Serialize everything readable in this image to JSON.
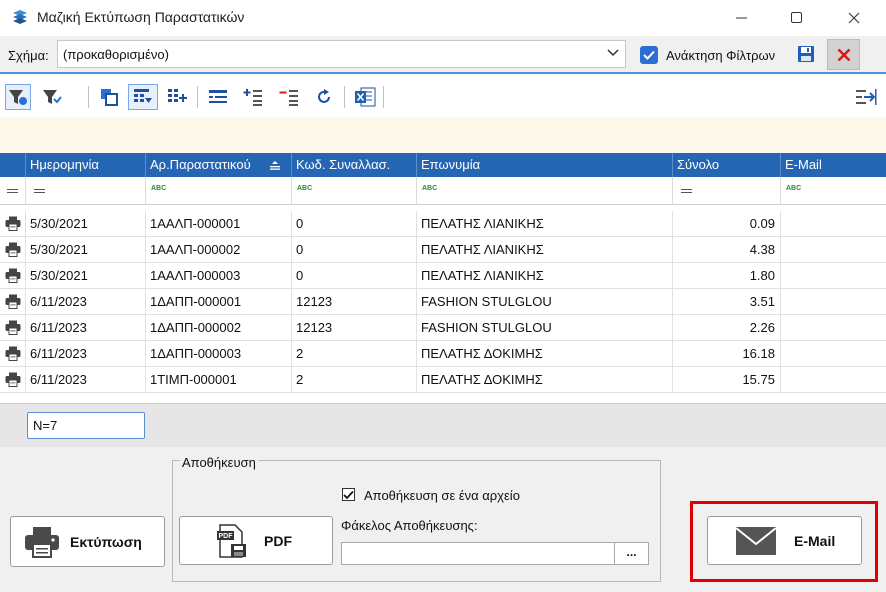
{
  "window": {
    "title": "Μαζική Εκτύπωση Παραστατικών",
    "minimize_glyph": "—",
    "maximize_glyph": "☐",
    "close_glyph": "✕"
  },
  "schema": {
    "label": "Σχήμα:",
    "value": "(προκαθορισμένο)",
    "filter_recall_label": "Ανάκτηση Φίλτρων",
    "filter_recall_checked": true
  },
  "toolbar": {
    "icons": [
      "filter-apply-icon",
      "filter-clear-icon",
      "copy-icon",
      "grid-options-icon",
      "add-columns-icon",
      "layout-icon",
      "expand-icon",
      "collapse-icon",
      "refresh-icon",
      "excel-export-icon",
      "pin-right-icon"
    ]
  },
  "grid": {
    "columns": [
      "Ημερομηνία",
      "Αρ.Παραστατικού",
      "Κωδ. Συναλλασ.",
      "Επωνυμία",
      "Σύνολο",
      "E-Mail"
    ],
    "sort_indicator": "≏",
    "filter_ops": [
      "=",
      "ABC",
      "ABC",
      "ABC",
      "=",
      "ABC"
    ],
    "rows": [
      {
        "date": "5/30/2021",
        "doc": "1ΑΑΛΠ-000001",
        "code": "0",
        "name": "ΠΕΛΑΤΗΣ ΛΙΑΝΙΚΗΣ",
        "total": "0.09",
        "email": ""
      },
      {
        "date": "5/30/2021",
        "doc": "1ΑΑΛΠ-000002",
        "code": "0",
        "name": "ΠΕΛΑΤΗΣ ΛΙΑΝΙΚΗΣ",
        "total": "4.38",
        "email": ""
      },
      {
        "date": "5/30/2021",
        "doc": "1ΑΑΛΠ-000003",
        "code": "0",
        "name": "ΠΕΛΑΤΗΣ ΛΙΑΝΙΚΗΣ",
        "total": "1.80",
        "email": ""
      },
      {
        "date": "6/11/2023",
        "doc": "1ΔΑΠΠ-000001",
        "code": "12123",
        "name": "FASHION STULGLOU",
        "total": "3.51",
        "email": ""
      },
      {
        "date": "6/11/2023",
        "doc": "1ΔΑΠΠ-000002",
        "code": "12123",
        "name": "FASHION STULGLOU",
        "total": "2.26",
        "email": ""
      },
      {
        "date": "6/11/2023",
        "doc": "1ΔΑΠΠ-000003",
        "code": "2",
        "name": "ΠΕΛΑΤΗΣ ΔΟΚΙΜΗΣ",
        "total": "16.18",
        "email": ""
      },
      {
        "date": "6/11/2023",
        "doc": "1ΤΙΜΠ-000001",
        "code": "2",
        "name": "ΠΕΛΑΤΗΣ ΔΟΚΙΜΗΣ",
        "total": "15.75",
        "email": ""
      }
    ],
    "count_text": "N=7"
  },
  "actions": {
    "print_label": "Εκτύπωση",
    "pdf_label": "PDF",
    "email_label": "E-Mail",
    "save_group_title": "Αποθήκευση",
    "save_one_file_label": "Αποθήκευση σε ένα αρχείο",
    "save_one_file_checked": true,
    "folder_label": "Φάκελος Αποθήκευσης:",
    "folder_value": "",
    "browse_label": "...",
    "highlight_color": "#e00000"
  },
  "colors": {
    "header_blue": "#2466b4",
    "accent_blue": "#2d6dd6",
    "filter_strip": "#fdf8ea"
  }
}
